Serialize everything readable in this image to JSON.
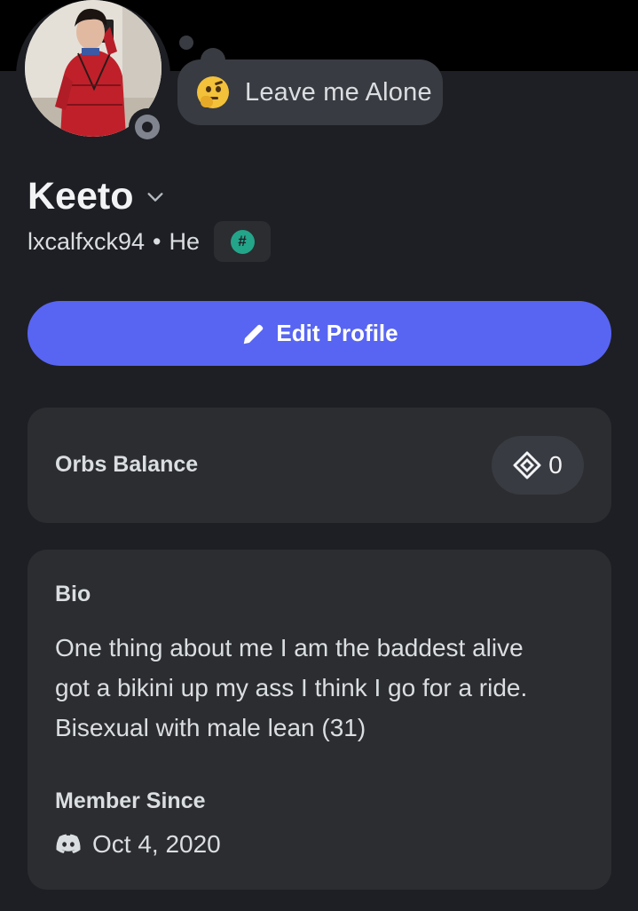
{
  "profile": {
    "display_name": "Keeto",
    "username": "lxcalfxck94",
    "separator": "•",
    "pronouns": "He",
    "tag_symbol": "#",
    "avatar_alt": "profile avatar",
    "status_indicator": "offline"
  },
  "custom_status": {
    "emoji": "thinking-face",
    "text": "Leave me Alone"
  },
  "actions": {
    "edit_profile_label": "Edit Profile"
  },
  "orbs": {
    "label": "Orbs Balance",
    "value": "0"
  },
  "bio": {
    "heading": "Bio",
    "lines": [
      "One thing about me I am the baddest alive",
      "got a bikini up my ass I think I go for a ride.",
      "Bisexual with male lean (31)"
    ]
  },
  "member_since": {
    "heading": "Member Since",
    "date": "Oct 4, 2020"
  },
  "colors": {
    "background": "#1e1f24",
    "card": "#2b2d31",
    "accent": "#5865f2",
    "tag_green": "#23a58a",
    "status_gray": "#80848e"
  }
}
